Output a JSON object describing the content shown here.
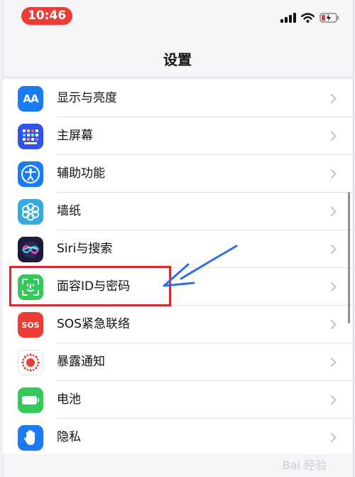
{
  "status_bar": {
    "time": "10:46"
  },
  "nav": {
    "title": "设置"
  },
  "settings": {
    "items": [
      {
        "label": "显示与亮度",
        "icon": "display-brightness-icon",
        "color": "#1a7cf5"
      },
      {
        "label": "主屏幕",
        "icon": "home-screen-icon",
        "color": "#2f54eb"
      },
      {
        "label": "辅助功能",
        "icon": "accessibility-icon",
        "color": "#1a7cf5"
      },
      {
        "label": "墙纸",
        "icon": "wallpaper-icon",
        "color": "#35aadc"
      },
      {
        "label": "Siri与搜索",
        "icon": "siri-icon",
        "color": "#1c1c3a"
      },
      {
        "label": "面容ID与密码",
        "icon": "face-id-icon",
        "color": "#34c759"
      },
      {
        "label": "SOS紧急联络",
        "icon": "sos-icon",
        "color": "#ef3b35"
      },
      {
        "label": "暴露通知",
        "icon": "exposure-notification-icon",
        "color": "#ffffff"
      },
      {
        "label": "电池",
        "icon": "battery-icon",
        "color": "#34c759"
      },
      {
        "label": "隐私",
        "icon": "privacy-hand-icon",
        "color": "#1a7cf5"
      }
    ]
  },
  "sos_icon_text": "SOS",
  "display_icon_text": "AA",
  "annotation": {
    "highlight_color": "#e0262c",
    "arrow_color": "#2f6fe6"
  },
  "watermark": "Bai 经验"
}
